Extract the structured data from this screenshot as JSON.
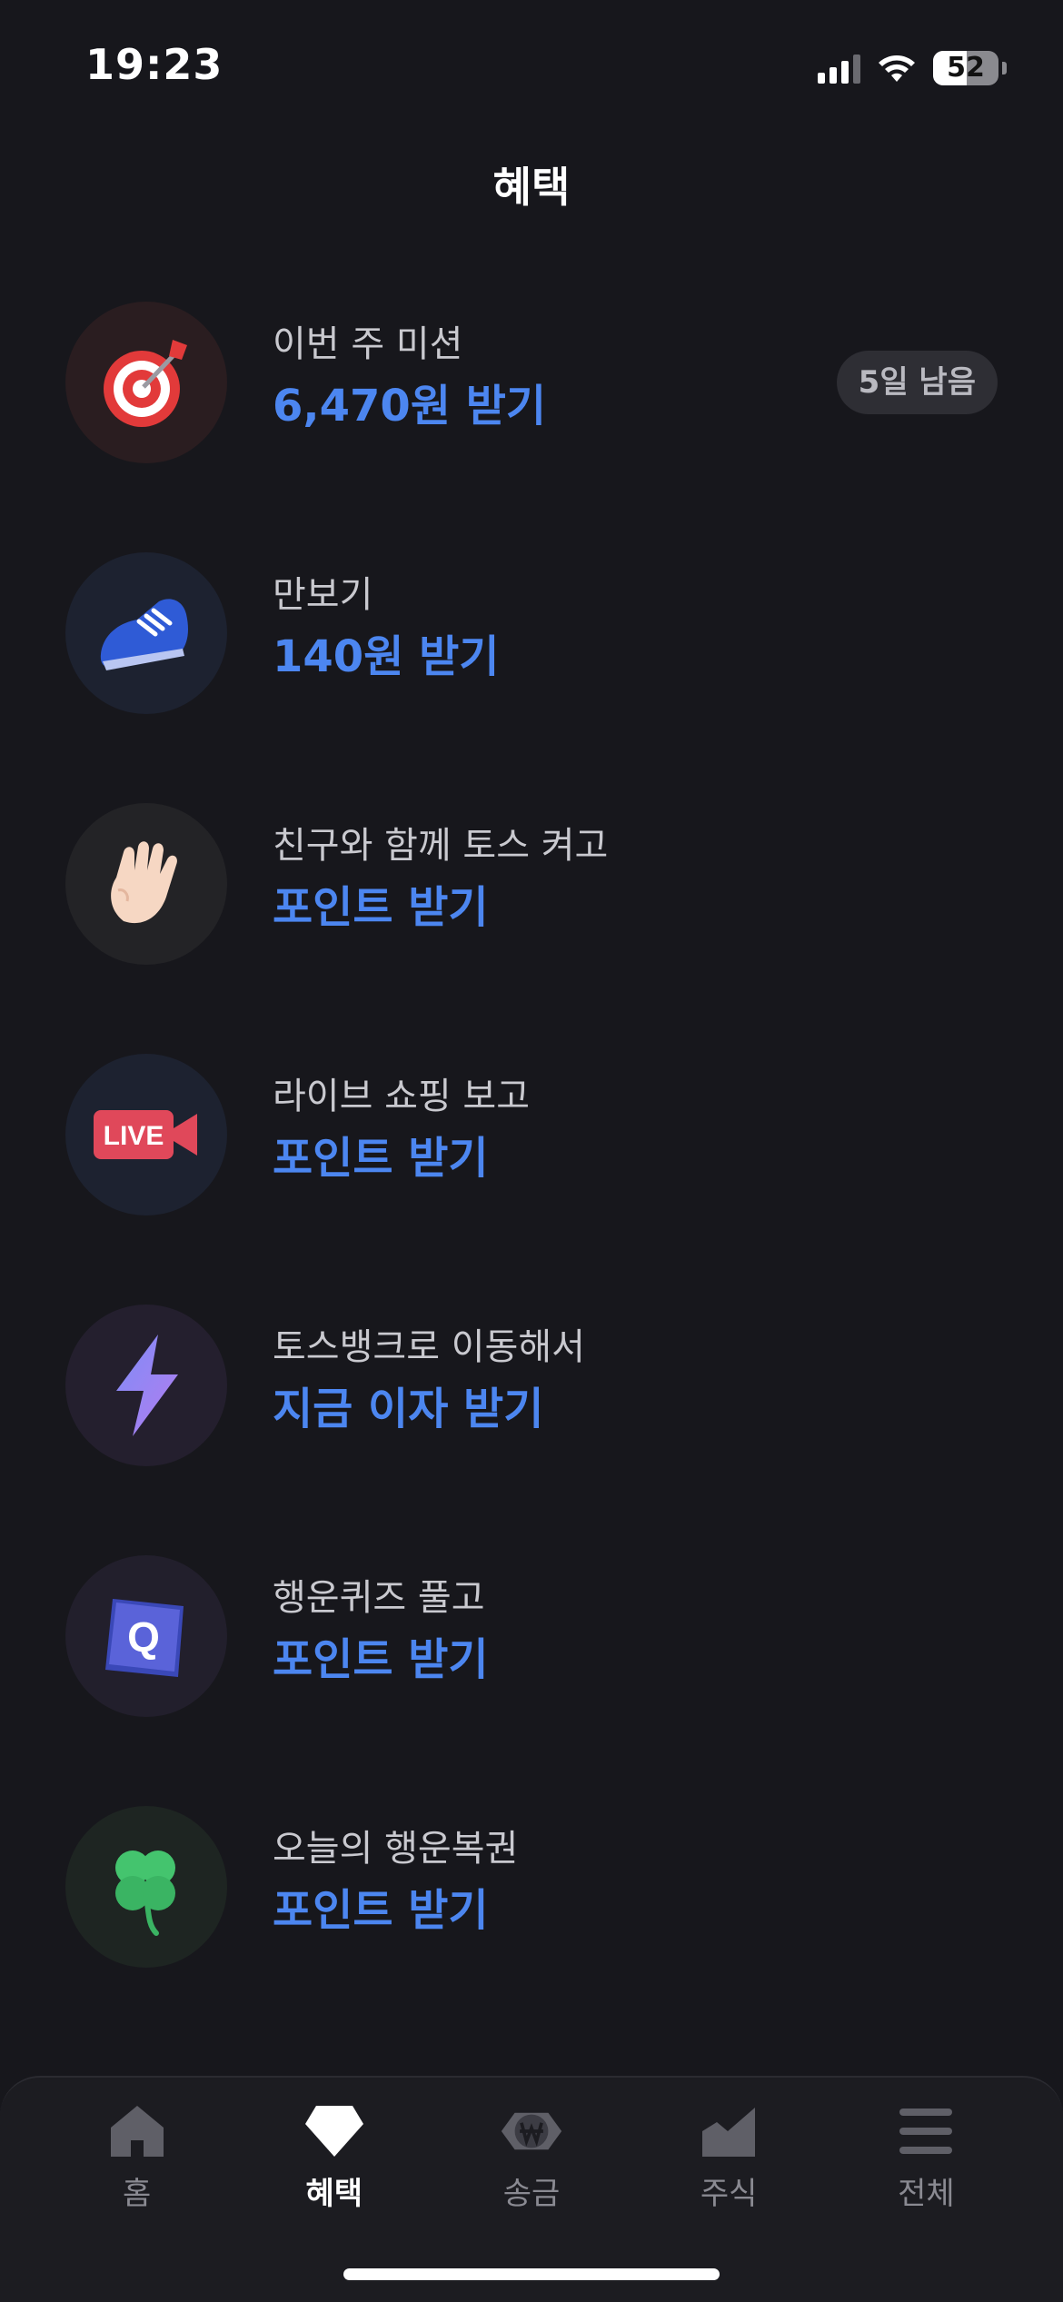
{
  "status_bar": {
    "time": "19:23",
    "battery": "52"
  },
  "header": {
    "title": "혜택"
  },
  "benefits": [
    {
      "subtitle": "이번 주 미션",
      "action": "6,470원 받기",
      "badge": "5일 남음",
      "icon": "dart-target-icon"
    },
    {
      "subtitle": "만보기",
      "action": "140원 받기",
      "icon": "sneaker-icon"
    },
    {
      "subtitle": "친구와 함께 토스 켜고",
      "action": "포인트 받기",
      "icon": "waving-hand-icon"
    },
    {
      "subtitle": "라이브 쇼핑 보고",
      "action": "포인트 받기",
      "icon": "live-camera-icon",
      "live_text": "LIVE"
    },
    {
      "subtitle": "토스뱅크로 이동해서",
      "action": "지금 이자 받기",
      "icon": "lightning-icon"
    },
    {
      "subtitle": "행운퀴즈 풀고",
      "action": "포인트 받기",
      "icon": "quiz-cube-icon",
      "quiz_letter": "Q"
    },
    {
      "subtitle": "오늘의 행운복권",
      "action": "포인트 받기",
      "icon": "four-leaf-clover-icon"
    }
  ],
  "tab_bar": {
    "tabs": [
      {
        "label": "홈",
        "icon": "home-icon",
        "active": false
      },
      {
        "label": "혜택",
        "icon": "diamond-icon",
        "active": true
      },
      {
        "label": "송금",
        "icon": "won-transfer-icon",
        "active": false
      },
      {
        "label": "주식",
        "icon": "stock-chart-icon",
        "active": false
      },
      {
        "label": "전체",
        "icon": "menu-icon",
        "active": false
      }
    ]
  },
  "colors": {
    "background": "#17171c",
    "accent": "#4c86f0",
    "text": "#e8e8ea"
  }
}
